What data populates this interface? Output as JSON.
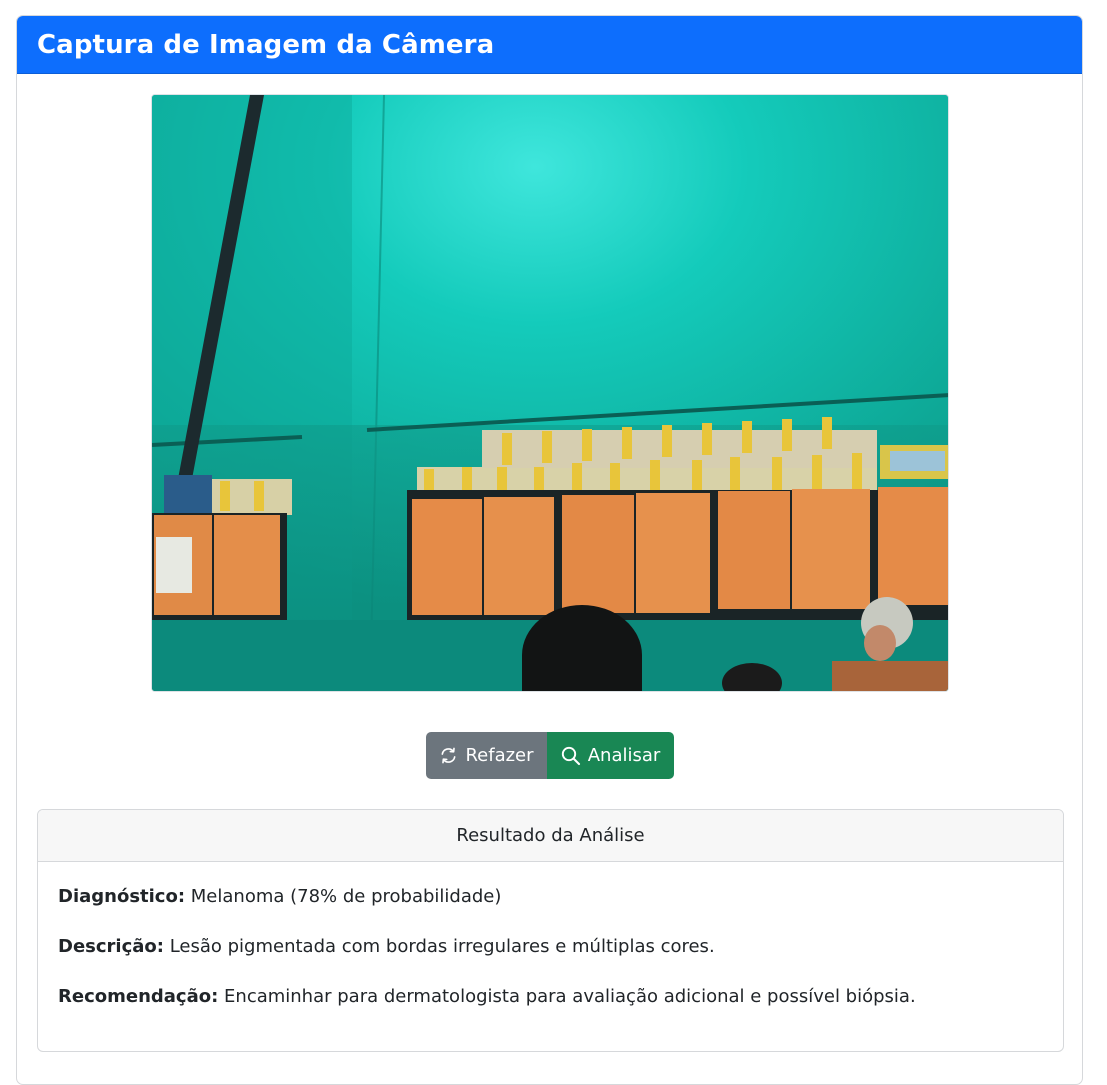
{
  "header": {
    "title": "Captura de Imagem da Câmera"
  },
  "capture": {
    "image_description": "webcam-photo"
  },
  "actions": {
    "redo_label": "Refazer",
    "analyze_label": "Analisar"
  },
  "result": {
    "title": "Resultado da Análise",
    "rows": [
      {
        "label": "Diagnóstico:",
        "value": "Melanoma (78% de probabilidade)"
      },
      {
        "label": "Descrição:",
        "value": "Lesão pigmentada com bordas irregulares e múltiplas cores."
      },
      {
        "label": "Recomendação:",
        "value": "Encaminhar para dermatologista para avaliação adicional e possível biópsia."
      }
    ]
  },
  "colors": {
    "header_bg": "#0d6efd",
    "redo_bg": "#6c757d",
    "analyze_bg": "#198754"
  }
}
